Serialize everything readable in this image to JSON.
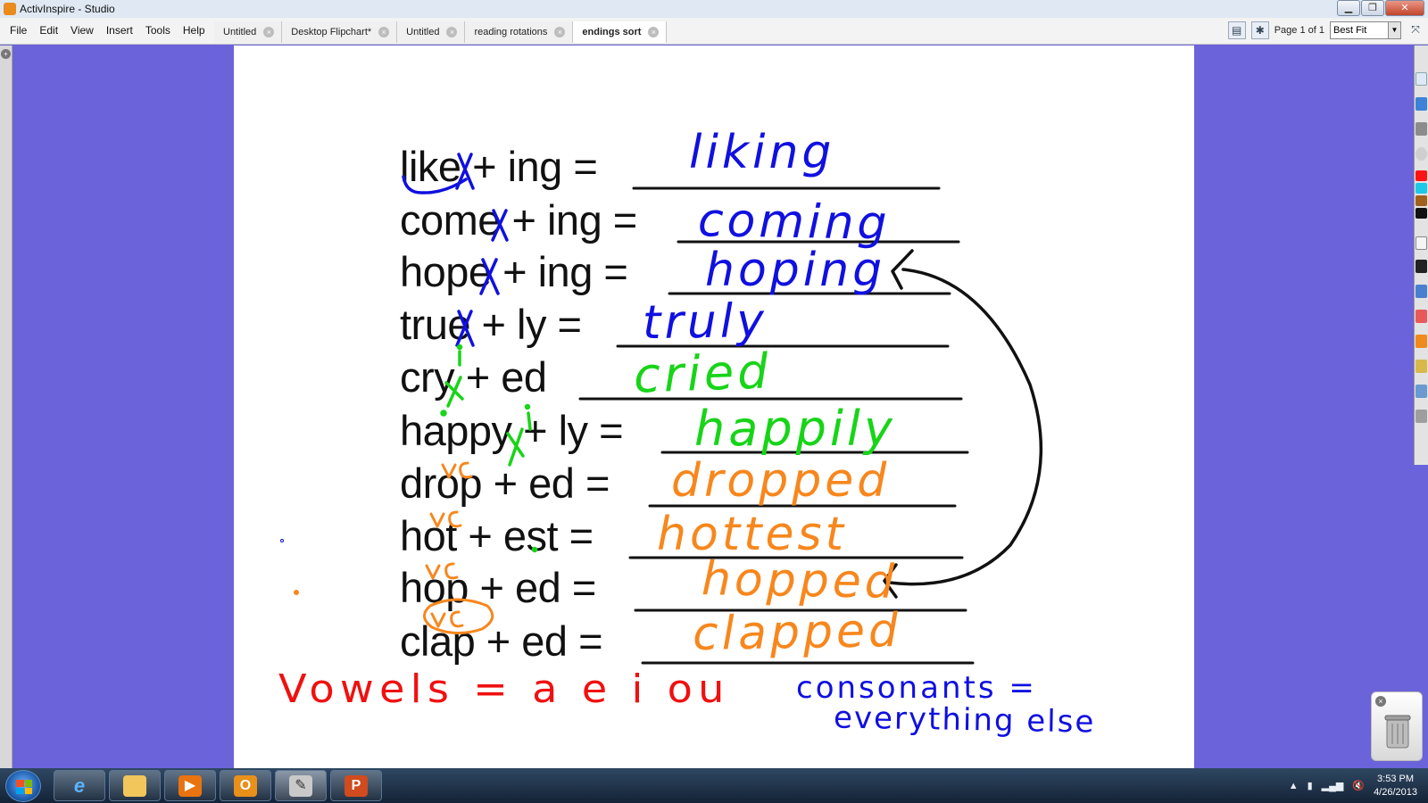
{
  "window": {
    "title": "ActivInspire - Studio",
    "minimize": "▁",
    "maximize": "❐",
    "close": "✕"
  },
  "menu": [
    "File",
    "Edit",
    "View",
    "Insert",
    "Tools",
    "Help"
  ],
  "tabs": [
    {
      "label": "Untitled",
      "active": false
    },
    {
      "label": "Desktop Flipchart*",
      "active": false
    },
    {
      "label": "Untitled",
      "active": false
    },
    {
      "label": "reading rotations",
      "active": false
    },
    {
      "label": "endings sort",
      "active": true
    }
  ],
  "toolbar_right": {
    "page_indicator": "Page 1 of 1",
    "zoom": "Best Fit"
  },
  "flipchart": {
    "equations": [
      {
        "text": "like + ing =",
        "answer": "liking",
        "ink": "#1010e0"
      },
      {
        "text": "come + ing =",
        "answer": "coming",
        "ink": "#1010e0"
      },
      {
        "text": "hope + ing =",
        "answer": "hoping",
        "ink": "#1010e0"
      },
      {
        "text": "true + ly =",
        "answer": "truly",
        "ink": "#1010e0"
      },
      {
        "text": "cry + ed",
        "answer": "cried",
        "ink": "#18d418"
      },
      {
        "text": "happy + ly =",
        "answer": "happily",
        "ink": "#18d418"
      },
      {
        "text": "drop + ed =",
        "answer": "dropped",
        "ink": "#f7871d"
      },
      {
        "text": "hot + est =",
        "answer": "hottest",
        "ink": "#f7871d"
      },
      {
        "text": "hop + ed =",
        "answer": "hopped",
        "ink": "#f7871d"
      },
      {
        "text": "clap + ed =",
        "answer": "clapped",
        "ink": "#f7871d"
      }
    ],
    "vowels_note": "Vowels = a e i ou",
    "consonants_note_line1": "consonants =",
    "consonants_note_line2": "everything else",
    "vc_marks": [
      "vc",
      "vc",
      "vc",
      "vc"
    ],
    "i_marks": [
      "i",
      "i"
    ]
  },
  "colors": {
    "background": "#6a63d9",
    "blue_ink": "#1010e0",
    "green_ink": "#18d418",
    "orange_ink": "#f7871d",
    "red_ink": "#f01010"
  },
  "taskbar": {
    "apps": [
      "windows-start",
      "internet-explorer",
      "file-explorer",
      "media-player",
      "outlook",
      "activinspire",
      "powerpoint"
    ],
    "outlook_glyph": "O",
    "powerpoint_glyph": "P",
    "time": "3:53 PM",
    "date": "4/26/2013"
  }
}
